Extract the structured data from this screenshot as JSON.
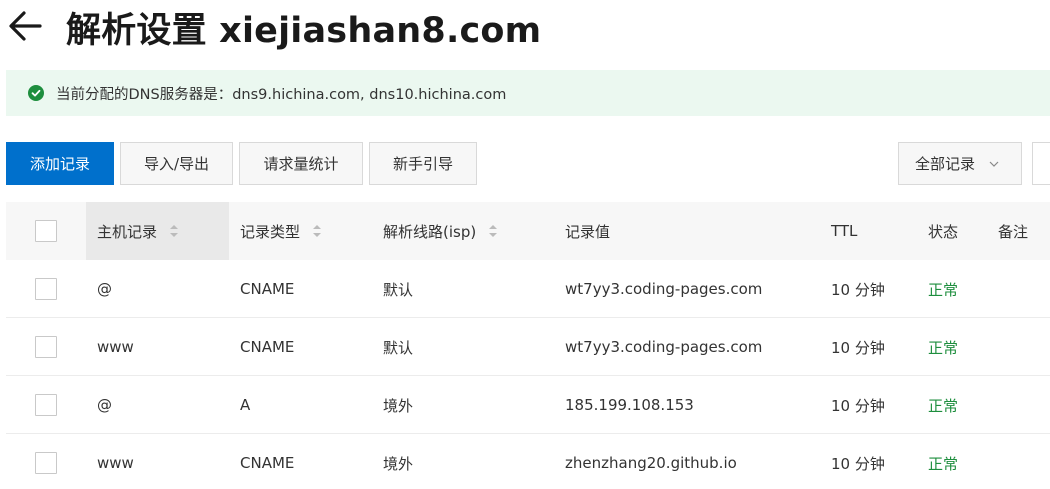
{
  "header": {
    "title": "解析设置 xiejiashan8.com"
  },
  "notice": {
    "text": "当前分配的DNS服务器是：dns9.hichina.com, dns10.hichina.com",
    "color": "#1e8e3e"
  },
  "toolbar": {
    "add_label": "添加记录",
    "import_label": "导入/导出",
    "stats_label": "请求量统计",
    "guide_label": "新手引导",
    "filter_label": "全部记录"
  },
  "table": {
    "columns": {
      "host": "主机记录",
      "type": "记录类型",
      "line": "解析线路(isp)",
      "value": "记录值",
      "ttl": "TTL",
      "status": "状态",
      "remark": "备注"
    },
    "rows": [
      {
        "host": "@",
        "type": "CNAME",
        "line": "默认",
        "value": "wt7yy3.coding-pages.com",
        "ttl": "10 分钟",
        "status": "正常"
      },
      {
        "host": "www",
        "type": "CNAME",
        "line": "默认",
        "value": "wt7yy3.coding-pages.com",
        "ttl": "10 分钟",
        "status": "正常"
      },
      {
        "host": "@",
        "type": "A",
        "line": "境外",
        "value": "185.199.108.153",
        "ttl": "10 分钟",
        "status": "正常"
      },
      {
        "host": "www",
        "type": "CNAME",
        "line": "境外",
        "value": "zhenzhang20.github.io",
        "ttl": "10 分钟",
        "status": "正常"
      }
    ]
  },
  "colors": {
    "primary": "#0070cc",
    "success": "#1e8e3e",
    "notice_bg": "#ebf8f0"
  }
}
